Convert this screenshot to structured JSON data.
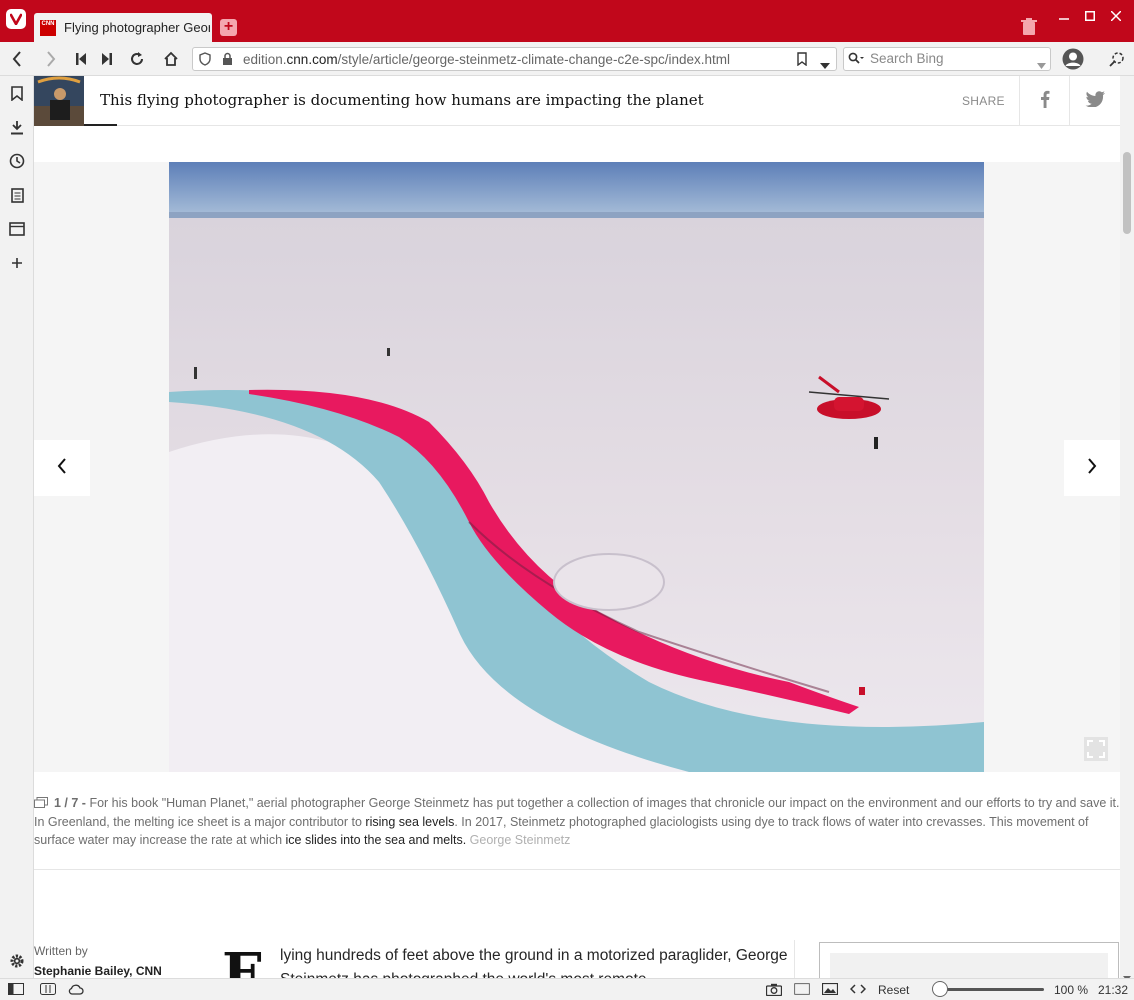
{
  "browser": {
    "tab_title": "Flying photographer George Steinmetz",
    "favicon_text": "CNN",
    "url_prefix": "edition.",
    "url_domain": "cnn.com",
    "url_path": "/style/article/george-steinmetz-climate-change-c2e-spc/index.html",
    "search_placeholder": "Search Bing",
    "accent_color": "#c1071b"
  },
  "article": {
    "headline": "This flying photographer is documenting how humans are impacting the planet",
    "share_label": "SHARE"
  },
  "gallery": {
    "counter": "1 / 7 -",
    "caption_part1": " For his book \"Human Planet,\" aerial photographer George Steinmetz has put together a collection of images that chronicle our impact on the environment and our efforts to try and save it. In Greenland, the melting ice sheet is a major contributor to ",
    "caption_link1": "rising sea levels",
    "caption_part2": ". In 2017, Steinmetz photographed glaciologists using dye to track flows of water into crevasses. This movement of surface water may increase the rate at which ",
    "caption_link2": "ice slides into the sea and melts.",
    "credit": " George Steinmetz"
  },
  "byline": {
    "written_by": "Written by",
    "author": "Stephanie Bailey, CNN"
  },
  "body": {
    "dropcap": "F",
    "text": "lying hundreds of feet above the ground in a motorized paraglider, George Steinmetz has photographed the world's most remote"
  },
  "statusbar": {
    "reset_label": "Reset",
    "zoom": "100 %",
    "zoom_level": 1.0,
    "time": "21:32"
  }
}
